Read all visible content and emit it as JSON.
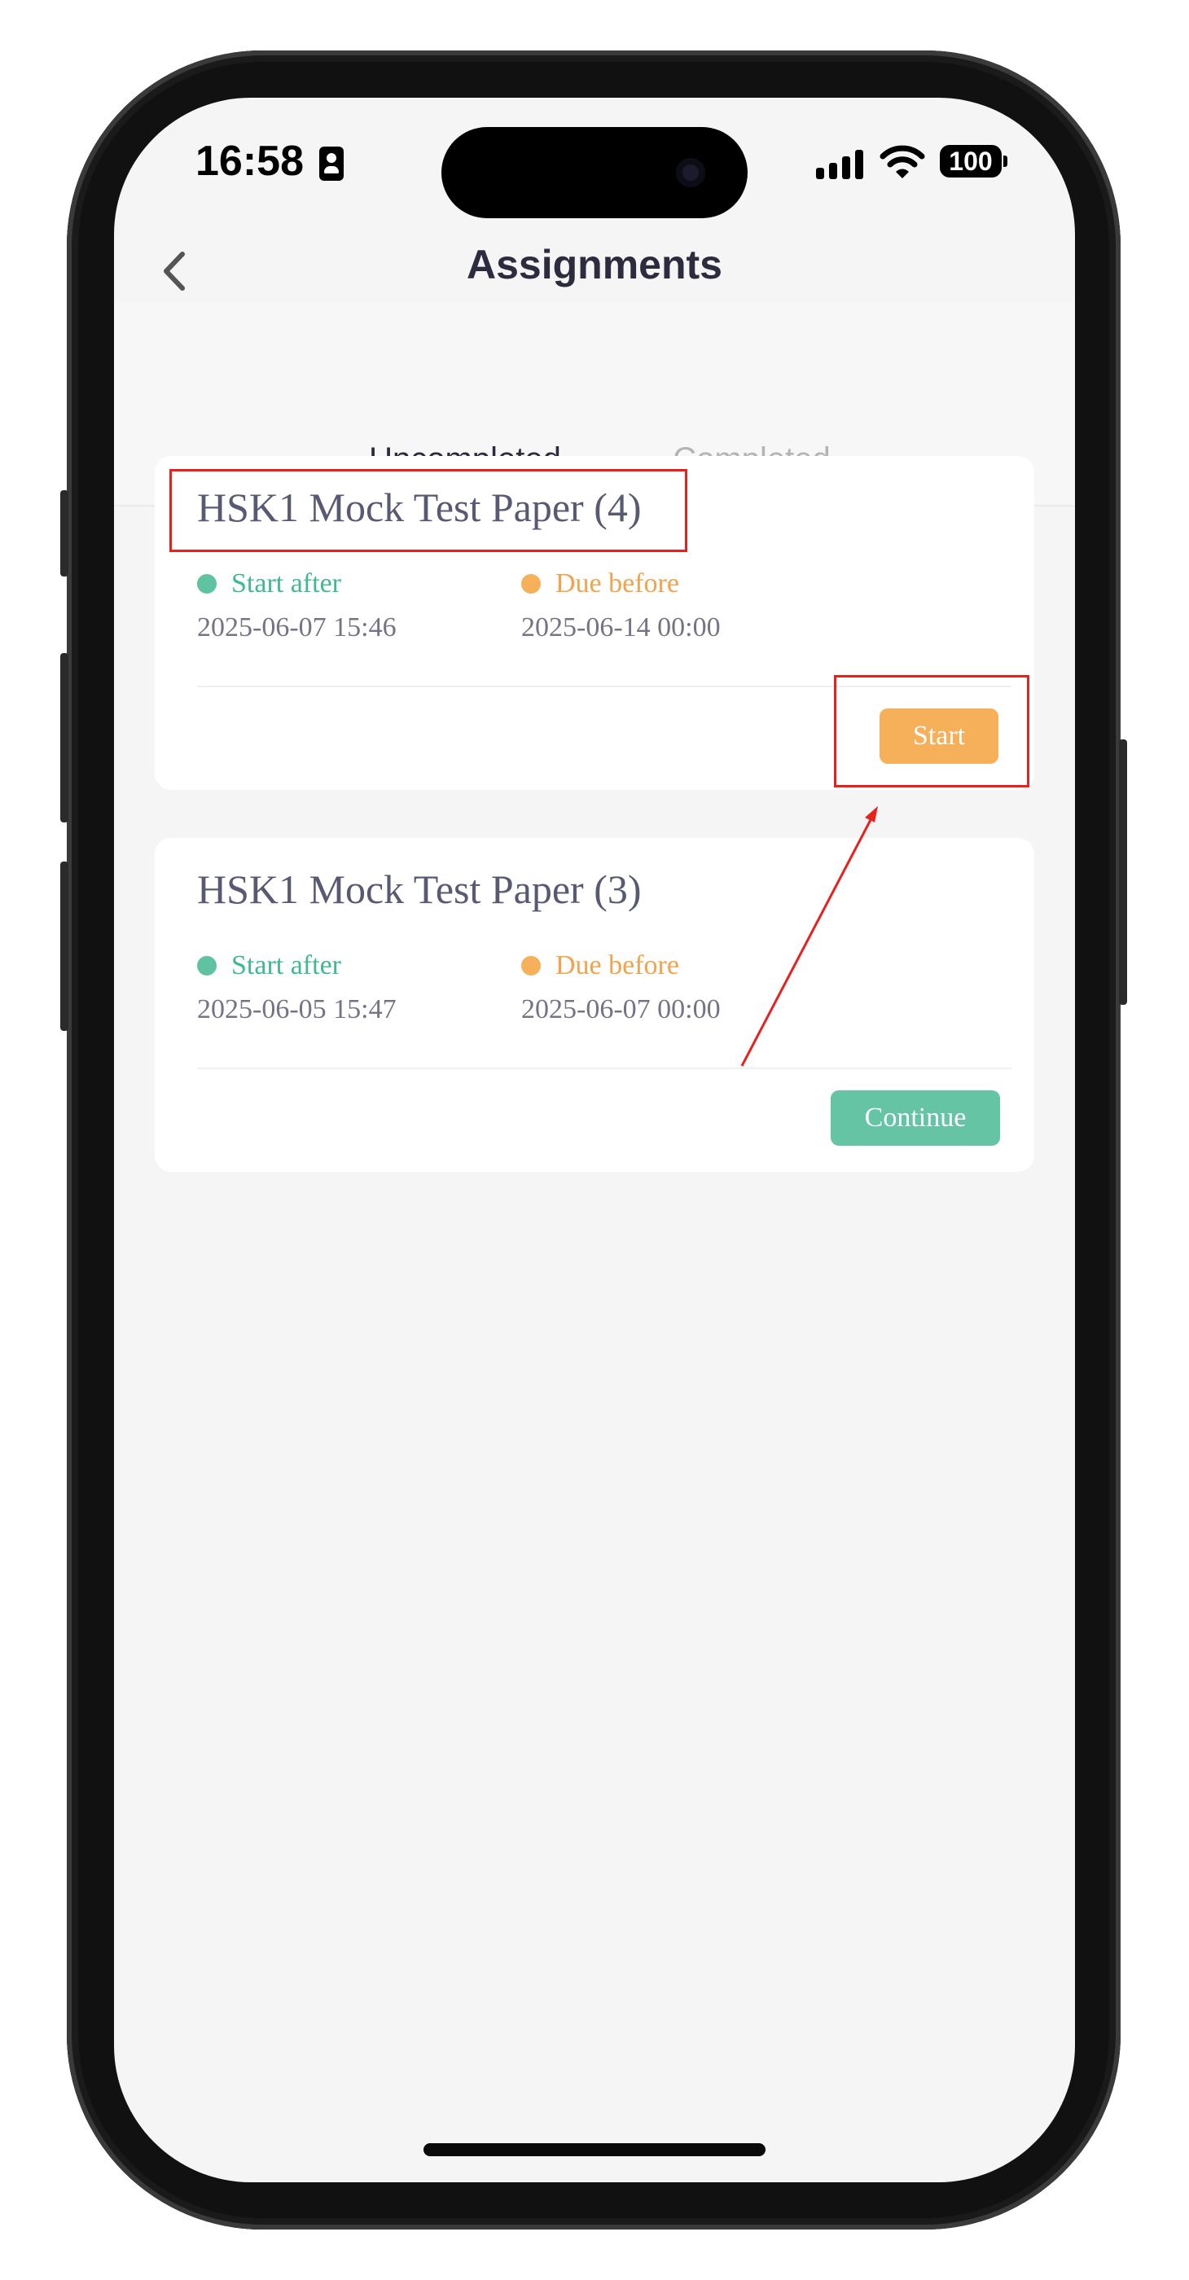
{
  "status_bar": {
    "time": "16:58",
    "battery": "100"
  },
  "header": {
    "title": "Assignments"
  },
  "tabs": [
    {
      "label": "Uncompleted",
      "active": true
    },
    {
      "label": "Completed",
      "active": false
    }
  ],
  "assignments": [
    {
      "title": "HSK1 Mock Test Paper (4)",
      "start_label": "Start after",
      "start_value": "2025-06-07 15:46",
      "due_label": "Due before",
      "due_value": "2025-06-14 00:00",
      "action_label": "Start"
    },
    {
      "title": "HSK1 Mock Test Paper (3)",
      "start_label": "Start after",
      "start_value": "2025-06-05 15:47",
      "due_label": "Due before",
      "due_value": "2025-06-07 00:00",
      "action_label": "Continue"
    }
  ],
  "colors": {
    "accent_orange": "#f6b05a",
    "accent_green": "#64c4a4",
    "annotation_red": "#e8211e",
    "title_text": "#2c2c3e"
  }
}
